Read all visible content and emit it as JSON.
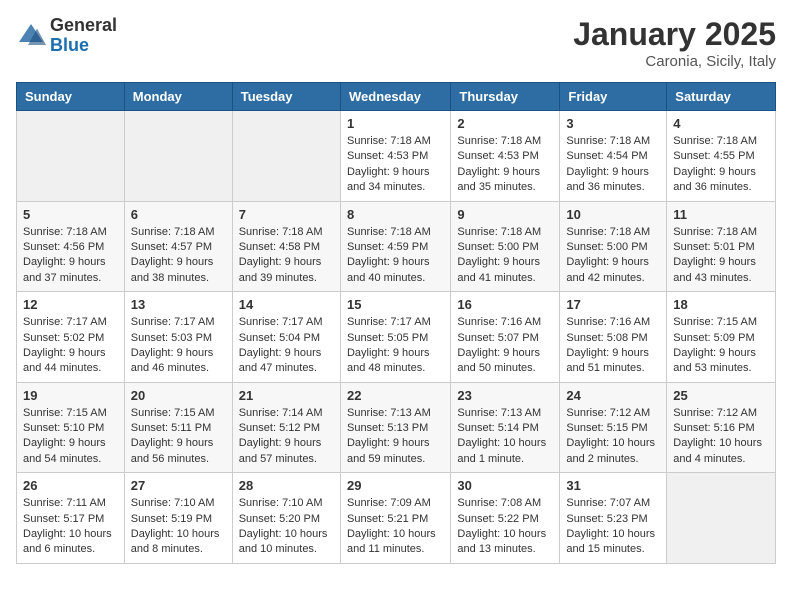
{
  "header": {
    "logo_general": "General",
    "logo_blue": "Blue",
    "month": "January 2025",
    "location": "Caronia, Sicily, Italy"
  },
  "days_of_week": [
    "Sunday",
    "Monday",
    "Tuesday",
    "Wednesday",
    "Thursday",
    "Friday",
    "Saturday"
  ],
  "weeks": [
    [
      {
        "day": "",
        "info": ""
      },
      {
        "day": "",
        "info": ""
      },
      {
        "day": "",
        "info": ""
      },
      {
        "day": "1",
        "info": "Sunrise: 7:18 AM\nSunset: 4:53 PM\nDaylight: 9 hours\nand 34 minutes."
      },
      {
        "day": "2",
        "info": "Sunrise: 7:18 AM\nSunset: 4:53 PM\nDaylight: 9 hours\nand 35 minutes."
      },
      {
        "day": "3",
        "info": "Sunrise: 7:18 AM\nSunset: 4:54 PM\nDaylight: 9 hours\nand 36 minutes."
      },
      {
        "day": "4",
        "info": "Sunrise: 7:18 AM\nSunset: 4:55 PM\nDaylight: 9 hours\nand 36 minutes."
      }
    ],
    [
      {
        "day": "5",
        "info": "Sunrise: 7:18 AM\nSunset: 4:56 PM\nDaylight: 9 hours\nand 37 minutes."
      },
      {
        "day": "6",
        "info": "Sunrise: 7:18 AM\nSunset: 4:57 PM\nDaylight: 9 hours\nand 38 minutes."
      },
      {
        "day": "7",
        "info": "Sunrise: 7:18 AM\nSunset: 4:58 PM\nDaylight: 9 hours\nand 39 minutes."
      },
      {
        "day": "8",
        "info": "Sunrise: 7:18 AM\nSunset: 4:59 PM\nDaylight: 9 hours\nand 40 minutes."
      },
      {
        "day": "9",
        "info": "Sunrise: 7:18 AM\nSunset: 5:00 PM\nDaylight: 9 hours\nand 41 minutes."
      },
      {
        "day": "10",
        "info": "Sunrise: 7:18 AM\nSunset: 5:00 PM\nDaylight: 9 hours\nand 42 minutes."
      },
      {
        "day": "11",
        "info": "Sunrise: 7:18 AM\nSunset: 5:01 PM\nDaylight: 9 hours\nand 43 minutes."
      }
    ],
    [
      {
        "day": "12",
        "info": "Sunrise: 7:17 AM\nSunset: 5:02 PM\nDaylight: 9 hours\nand 44 minutes."
      },
      {
        "day": "13",
        "info": "Sunrise: 7:17 AM\nSunset: 5:03 PM\nDaylight: 9 hours\nand 46 minutes."
      },
      {
        "day": "14",
        "info": "Sunrise: 7:17 AM\nSunset: 5:04 PM\nDaylight: 9 hours\nand 47 minutes."
      },
      {
        "day": "15",
        "info": "Sunrise: 7:17 AM\nSunset: 5:05 PM\nDaylight: 9 hours\nand 48 minutes."
      },
      {
        "day": "16",
        "info": "Sunrise: 7:16 AM\nSunset: 5:07 PM\nDaylight: 9 hours\nand 50 minutes."
      },
      {
        "day": "17",
        "info": "Sunrise: 7:16 AM\nSunset: 5:08 PM\nDaylight: 9 hours\nand 51 minutes."
      },
      {
        "day": "18",
        "info": "Sunrise: 7:15 AM\nSunset: 5:09 PM\nDaylight: 9 hours\nand 53 minutes."
      }
    ],
    [
      {
        "day": "19",
        "info": "Sunrise: 7:15 AM\nSunset: 5:10 PM\nDaylight: 9 hours\nand 54 minutes."
      },
      {
        "day": "20",
        "info": "Sunrise: 7:15 AM\nSunset: 5:11 PM\nDaylight: 9 hours\nand 56 minutes."
      },
      {
        "day": "21",
        "info": "Sunrise: 7:14 AM\nSunset: 5:12 PM\nDaylight: 9 hours\nand 57 minutes."
      },
      {
        "day": "22",
        "info": "Sunrise: 7:13 AM\nSunset: 5:13 PM\nDaylight: 9 hours\nand 59 minutes."
      },
      {
        "day": "23",
        "info": "Sunrise: 7:13 AM\nSunset: 5:14 PM\nDaylight: 10 hours\nand 1 minute."
      },
      {
        "day": "24",
        "info": "Sunrise: 7:12 AM\nSunset: 5:15 PM\nDaylight: 10 hours\nand 2 minutes."
      },
      {
        "day": "25",
        "info": "Sunrise: 7:12 AM\nSunset: 5:16 PM\nDaylight: 10 hours\nand 4 minutes."
      }
    ],
    [
      {
        "day": "26",
        "info": "Sunrise: 7:11 AM\nSunset: 5:17 PM\nDaylight: 10 hours\nand 6 minutes."
      },
      {
        "day": "27",
        "info": "Sunrise: 7:10 AM\nSunset: 5:19 PM\nDaylight: 10 hours\nand 8 minutes."
      },
      {
        "day": "28",
        "info": "Sunrise: 7:10 AM\nSunset: 5:20 PM\nDaylight: 10 hours\nand 10 minutes."
      },
      {
        "day": "29",
        "info": "Sunrise: 7:09 AM\nSunset: 5:21 PM\nDaylight: 10 hours\nand 11 minutes."
      },
      {
        "day": "30",
        "info": "Sunrise: 7:08 AM\nSunset: 5:22 PM\nDaylight: 10 hours\nand 13 minutes."
      },
      {
        "day": "31",
        "info": "Sunrise: 7:07 AM\nSunset: 5:23 PM\nDaylight: 10 hours\nand 15 minutes."
      },
      {
        "day": "",
        "info": ""
      }
    ]
  ]
}
